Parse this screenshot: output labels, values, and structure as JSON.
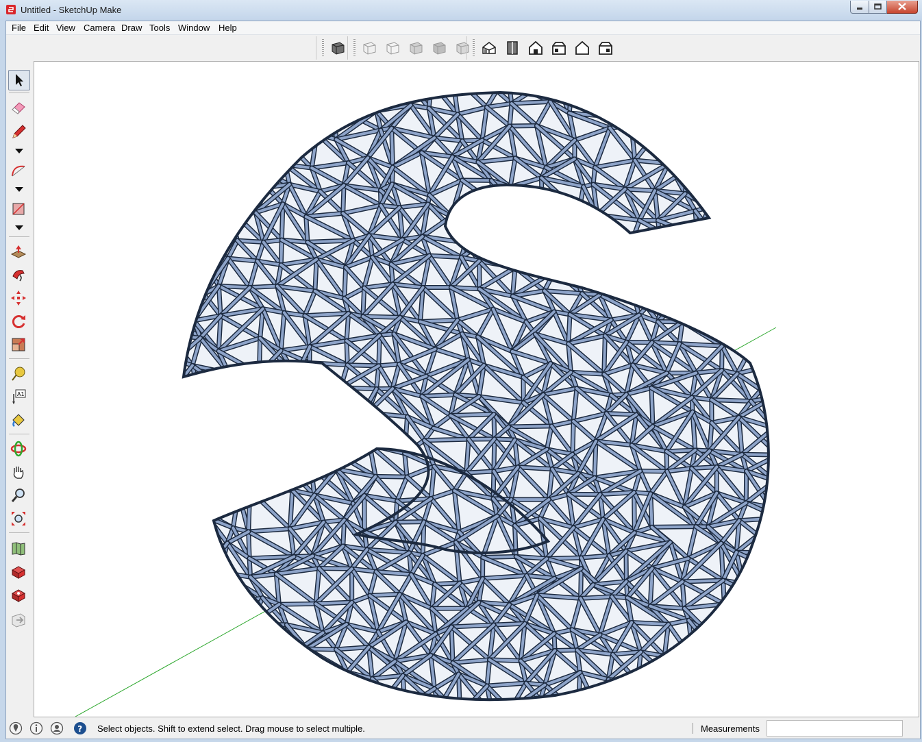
{
  "window": {
    "title": "Untitled - SketchUp Make",
    "app_icon": "sketchup-logo-icon",
    "controls": [
      "minimize-icon",
      "maximize-icon",
      "close-icon"
    ]
  },
  "menu": {
    "items": [
      {
        "label": "File",
        "accel": "F"
      },
      {
        "label": "Edit",
        "accel": "E"
      },
      {
        "label": "View",
        "accel": "V"
      },
      {
        "label": "Camera",
        "accel": "C"
      },
      {
        "label": "Draw",
        "accel": "D"
      },
      {
        "label": "Tools",
        "accel": "T"
      },
      {
        "label": "Window",
        "accel": "W"
      },
      {
        "label": "Help",
        "accel": "H"
      }
    ]
  },
  "toolbars": {
    "styles": [
      "x-ray-icon"
    ],
    "face_styles": [
      "wireframe-icon",
      "hidden-line-icon",
      "shaded-icon",
      "shaded-textures-icon",
      "monochrome-icon"
    ],
    "views": [
      "iso-view-icon",
      "top-view-icon",
      "front-view-icon",
      "right-view-icon",
      "back-view-icon",
      "left-view-icon"
    ]
  },
  "left_tools": [
    "select-arrow-icon",
    "eraser-icon",
    "pencil-icon",
    "arc-icon",
    "rectangle-icon",
    "push-pull-icon",
    "follow-me-icon",
    "move-icon",
    "rotate-icon",
    "scale-icon",
    "tape-measure-icon",
    "text-icon",
    "paint-bucket-icon",
    "orbit-icon",
    "pan-icon",
    "zoom-icon",
    "zoom-extents-icon",
    "add-location-icon",
    "3d-warehouse-icon",
    "extension-warehouse-icon",
    "send-to-layout-icon"
  ],
  "status": {
    "text": "Select objects. Shift to extend select. Drag mouse to select multiple.",
    "measurements_label": "Measurements",
    "measurements_value": "",
    "icons": [
      "geo-location-icon",
      "credits-icon",
      "user-icon",
      "help-icon"
    ]
  },
  "colors": {
    "model_fill": "#8ea4c9",
    "model_stroke": "#1c2a40",
    "green_axis": "#2ea82e",
    "titlebar": "#c6d7ea",
    "close_button": "#c7452f"
  }
}
